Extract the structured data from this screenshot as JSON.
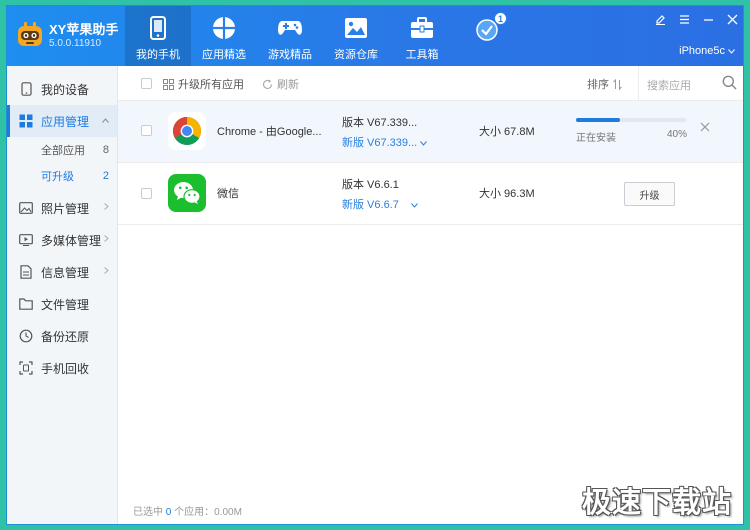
{
  "app": {
    "name": "XY苹果助手",
    "version": "5.0.0.11910"
  },
  "nav": {
    "tabs": [
      {
        "label": "我的手机",
        "icon": "phone-icon",
        "active": true
      },
      {
        "label": "应用精选",
        "icon": "apps-grid-icon",
        "active": false
      },
      {
        "label": "游戏精品",
        "icon": "gamepad-icon",
        "active": false
      },
      {
        "label": "资源仓库",
        "icon": "image-icon",
        "active": false
      },
      {
        "label": "工具箱",
        "icon": "toolbox-icon",
        "active": false
      }
    ],
    "download_badge": "1"
  },
  "device": {
    "name": "iPhone5c"
  },
  "sidebar": {
    "items": [
      {
        "label": "我的设备",
        "icon": "device-icon"
      },
      {
        "label": "应用管理",
        "icon": "app-manage-icon",
        "active": true
      },
      {
        "label": "照片管理",
        "icon": "photo-icon"
      },
      {
        "label": "多媒体管理",
        "icon": "media-icon"
      },
      {
        "label": "信息管理",
        "icon": "message-icon"
      },
      {
        "label": "文件管理",
        "icon": "folder-icon"
      },
      {
        "label": "备份还原",
        "icon": "backup-icon"
      },
      {
        "label": "手机回收",
        "icon": "recycle-icon"
      }
    ],
    "subitems": [
      {
        "label": "全部应用",
        "count": "8"
      },
      {
        "label": "可升级",
        "count": "2",
        "active": true
      }
    ]
  },
  "toolbar": {
    "upgrade_all": "升级所有应用",
    "refresh": "刷新",
    "sort": "排序",
    "search_placeholder": "搜索应用"
  },
  "apps": [
    {
      "name": "Chrome - 由Google...",
      "version": "版本 V67.339...",
      "new_version": "新版 V67.339...",
      "size": "大小 67.8M",
      "status": "正在安装",
      "progress": 40,
      "progress_text": "40%"
    },
    {
      "name": "微信",
      "version": "版本 V6.6.1",
      "new_version": "新版 V6.6.7",
      "size": "大小 96.3M",
      "action": "升级"
    }
  ],
  "status_bar": {
    "prefix": "已选中",
    "count": "0",
    "suffix": "个应用：0.00M"
  },
  "watermark": "极速下载站",
  "colors": {
    "header": "#2a80ea",
    "accent": "#1e7be0",
    "background": "#2fc2a6"
  }
}
